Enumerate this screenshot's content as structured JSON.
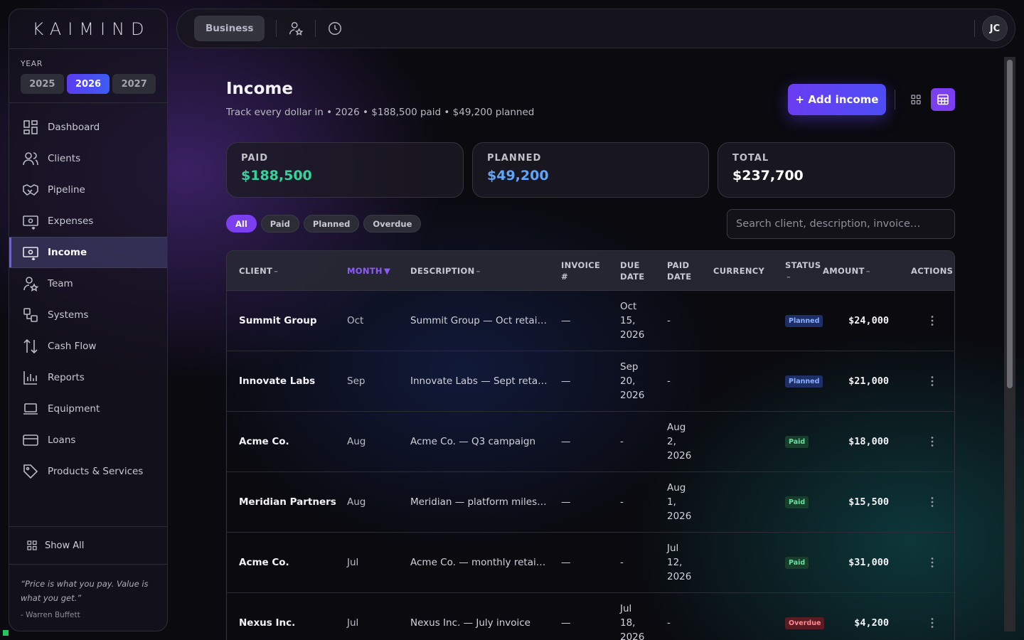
{
  "app": {
    "logo": "KAIMIND"
  },
  "sidebar": {
    "year_label": "YEAR",
    "years": [
      "2025",
      "2026",
      "2027"
    ],
    "selected_year": "2026",
    "items": [
      {
        "label": "Dashboard",
        "icon": "dashboard-icon"
      },
      {
        "label": "Clients",
        "icon": "users-icon"
      },
      {
        "label": "Pipeline",
        "icon": "handshake-icon"
      },
      {
        "label": "Expenses",
        "icon": "expense-icon"
      },
      {
        "label": "Income",
        "icon": "income-icon",
        "active": true
      },
      {
        "label": "Team",
        "icon": "team-icon"
      },
      {
        "label": "Systems",
        "icon": "systems-icon"
      },
      {
        "label": "Cash Flow",
        "icon": "arrows-updown-icon"
      },
      {
        "label": "Reports",
        "icon": "bar-chart-icon"
      },
      {
        "label": "Equipment",
        "icon": "laptop-icon"
      },
      {
        "label": "Loans",
        "icon": "card-icon"
      },
      {
        "label": "Products & Services",
        "icon": "tag-icon"
      }
    ],
    "show_all": "Show All",
    "quote": "“Price is what you pay. Value is what you get.”",
    "quote_author": "- Warren Buffett"
  },
  "topbar": {
    "business_label": "Business",
    "avatar_initials": "JC"
  },
  "header": {
    "title": "Income",
    "subtitle": "Track every dollar in • 2026 • $188,500 paid • $49,200 planned",
    "add_button": "+ Add income"
  },
  "cards": [
    {
      "label": "PAID",
      "value": "$188,500",
      "color": "#34d399"
    },
    {
      "label": "PLANNED",
      "value": "$49,200",
      "color": "#60a5fa"
    },
    {
      "label": "TOTAL",
      "value": "$237,700",
      "color": "#ffffff"
    }
  ],
  "filters": [
    "All",
    "Paid",
    "Planned",
    "Overdue"
  ],
  "active_filter": "All",
  "search": {
    "placeholder": "Search client, description, invoice…",
    "value": ""
  },
  "table": {
    "columns": [
      {
        "line1": "CLIENT",
        "sort": "–"
      },
      {
        "line1": "MONTH",
        "sort": "▼",
        "sorted": true
      },
      {
        "line1": "DESCRIPTION",
        "sort": "–"
      },
      {
        "line1": "INVOICE",
        "line2": "#"
      },
      {
        "line1": "DUE",
        "line2": "DATE"
      },
      {
        "line1": "PAID",
        "line2": "DATE"
      },
      {
        "line1": "CURRENCY"
      },
      {
        "line1": "STATUS",
        "line2": "–"
      },
      {
        "line1": "AMOUNT",
        "sort": "–"
      },
      {
        "line1": "ACTIONS"
      }
    ],
    "rows": [
      {
        "client": "Summit Group",
        "month": "Oct",
        "description": "Summit Group — Oct retai…",
        "invoice": "—",
        "due": [
          "Oct",
          "15,",
          "2026"
        ],
        "paid": [
          "-"
        ],
        "currency": "",
        "status": "Planned",
        "amount": "$24,000"
      },
      {
        "client": "Innovate Labs",
        "month": "Sep",
        "description": "Innovate Labs — Sept reta…",
        "invoice": "—",
        "due": [
          "Sep",
          "20,",
          "2026"
        ],
        "paid": [
          "-"
        ],
        "currency": "",
        "status": "Planned",
        "amount": "$21,000"
      },
      {
        "client": "Acme Co.",
        "month": "Aug",
        "description": "Acme Co. — Q3 campaign",
        "invoice": "—",
        "due": [
          "-"
        ],
        "paid": [
          "Aug",
          "2,",
          "2026"
        ],
        "currency": "",
        "status": "Paid",
        "amount": "$18,000"
      },
      {
        "client": "Meridian Partners",
        "month": "Aug",
        "description": "Meridian — platform miles…",
        "invoice": "—",
        "due": [
          "-"
        ],
        "paid": [
          "Aug",
          "1,",
          "2026"
        ],
        "currency": "",
        "status": "Paid",
        "amount": "$15,500"
      },
      {
        "client": "Acme Co.",
        "month": "Jul",
        "description": "Acme Co. — monthly retai…",
        "invoice": "—",
        "due": [
          "-"
        ],
        "paid": [
          "Jul",
          "12,",
          "2026"
        ],
        "currency": "",
        "status": "Paid",
        "amount": "$31,000"
      },
      {
        "client": "Nexus Inc.",
        "month": "Jul",
        "description": "Nexus Inc. — July invoice",
        "invoice": "—",
        "due": [
          "Jul",
          "18,",
          "2026"
        ],
        "paid": [
          "-"
        ],
        "currency": "",
        "status": "Overdue",
        "amount": "$4,200"
      }
    ]
  }
}
